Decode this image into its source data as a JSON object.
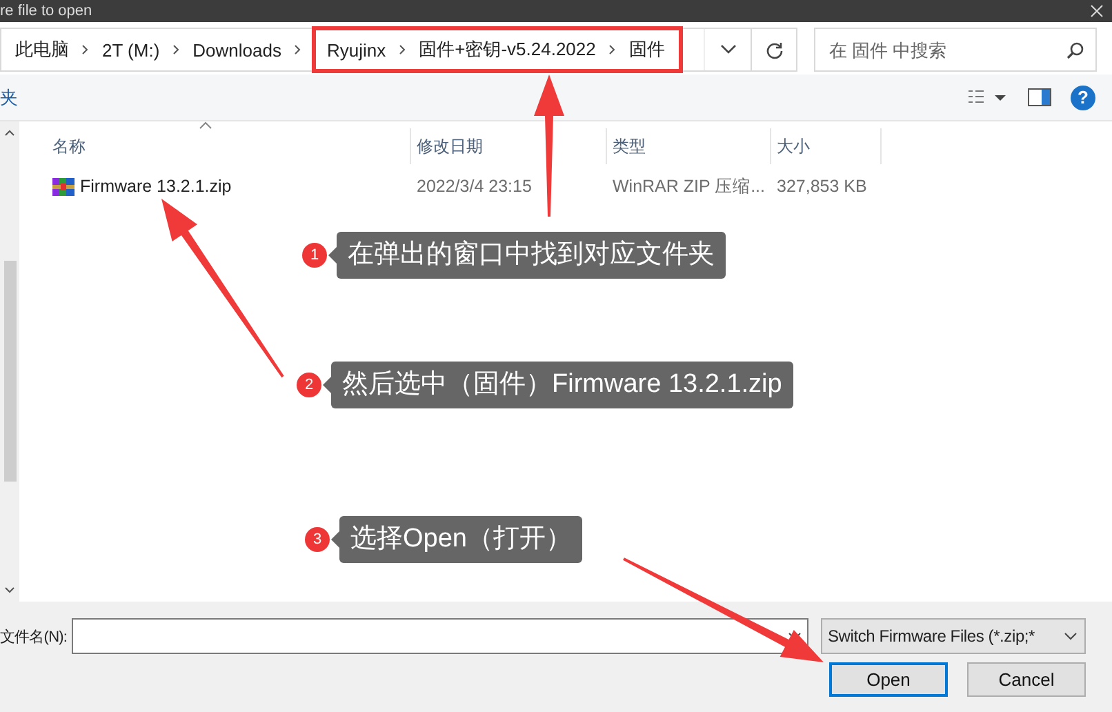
{
  "window": {
    "title": "re file to open"
  },
  "address": {
    "segments": [
      "此电脑",
      "2T (M:)",
      "Downloads"
    ],
    "highlighted_segments": [
      "Ryujinx",
      "固件+密钥-v5.24.2022",
      "固件"
    ]
  },
  "search": {
    "placeholder": "在 固件 中搜索"
  },
  "toolbar": {
    "left_label": "夹",
    "help": "?"
  },
  "table": {
    "columns": [
      "名称",
      "修改日期",
      "类型",
      "大小"
    ],
    "rows": [
      {
        "name": "Firmware 13.2.1.zip",
        "modified": "2022/3/4 23:15",
        "type": "WinRAR ZIP 压缩...",
        "size": "327,853 KB",
        "selected": false
      }
    ]
  },
  "footer": {
    "filename_label": "文件名(N):",
    "filter": "Switch Firmware Files (*.zip;*",
    "buttons": [
      {
        "label": "Open",
        "kind": "default"
      },
      {
        "label": "Cancel",
        "kind": "normal"
      }
    ]
  },
  "callouts": [
    {
      "number": "1",
      "text": "在弹出的窗口中找到对应文件夹"
    },
    {
      "number": "2",
      "text": "然后选中（固件）Firmware 13.2.1.zip"
    },
    {
      "number": "3",
      "text": "选择Open（打开）"
    }
  ]
}
